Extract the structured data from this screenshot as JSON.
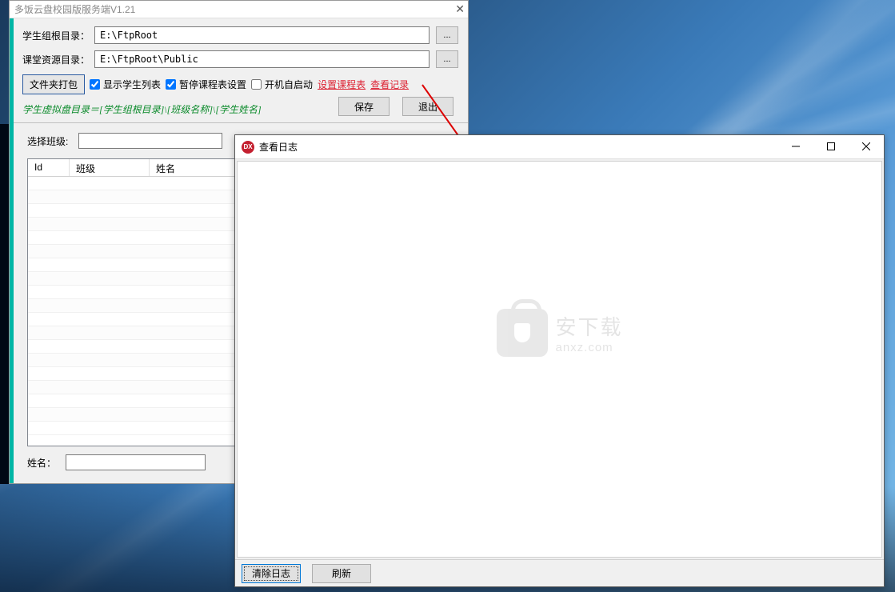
{
  "mainWindow": {
    "title": "多饭云盘校园版服务端V1.21",
    "rootDirLabel": "学生组根目录：",
    "rootDirValue": "E:\\FtpRoot",
    "resourceDirLabel": "课堂资源目录：",
    "resourceDirValue": "E:\\FtpRoot\\Public",
    "browseLabel": "...",
    "packBtn": "文件夹打包",
    "chkShowList": "显示学生列表",
    "chkPauseSchedule": "暂停课程表设置",
    "chkAutoStart": "开机自启动",
    "linkSchedule": "设置课程表",
    "linkViewLog": "查看记录",
    "pathNote": "学生虚拟盘目录＝[学生组根目录]\\[班级名称]\\[学生姓名]",
    "saveBtn": "保存",
    "exitBtn": "退出",
    "selectClassLabel": "选择班级:",
    "table": {
      "colId": "Id",
      "colClass": "班级",
      "colName": "姓名"
    },
    "bottomNameLabel": "姓名："
  },
  "logWindow": {
    "icon": "DX",
    "title": "查看日志",
    "clearBtn": "清除日志",
    "refreshBtn": "刷新"
  },
  "watermark": {
    "cn": "安下载",
    "en": "anxz.com"
  }
}
